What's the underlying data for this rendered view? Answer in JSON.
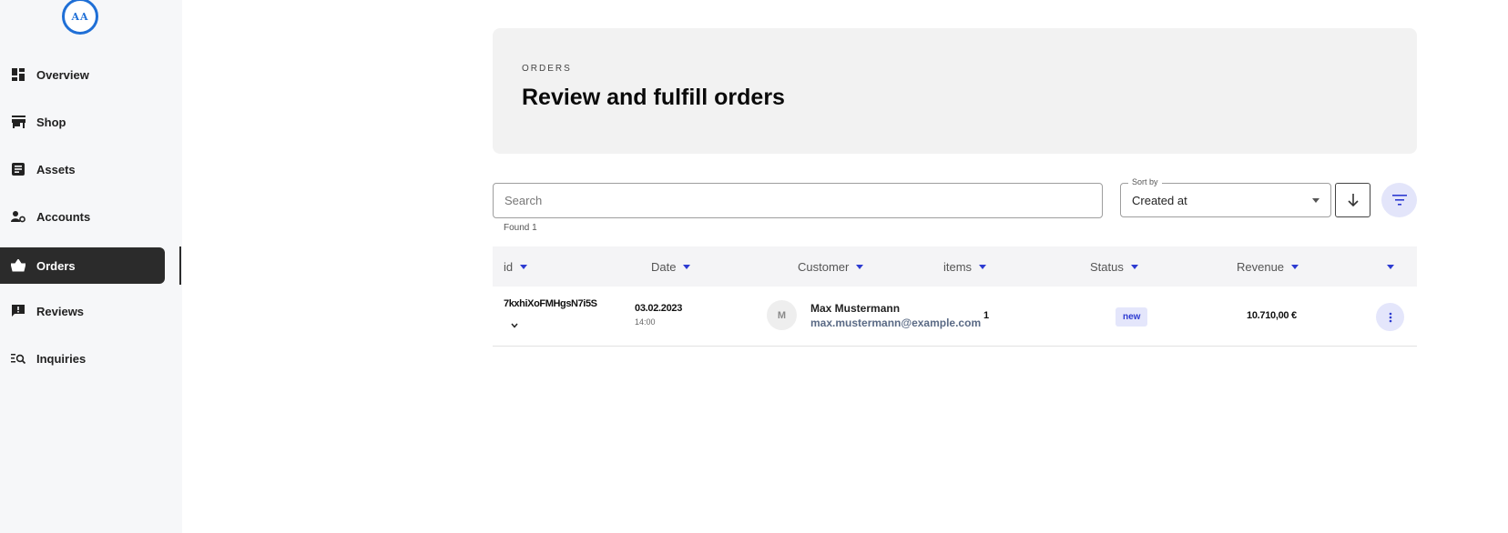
{
  "app": {
    "logo_text": "AA"
  },
  "sidebar": {
    "items": [
      {
        "label": "Overview",
        "icon": "dashboard-icon",
        "active": false
      },
      {
        "label": "Shop",
        "icon": "store-icon",
        "active": false
      },
      {
        "label": "Assets",
        "icon": "document-icon",
        "active": false
      },
      {
        "label": "Accounts",
        "icon": "account-settings-icon",
        "active": false
      },
      {
        "label": "Orders",
        "icon": "basket-icon",
        "active": true
      },
      {
        "label": "Reviews",
        "icon": "review-feedback-icon",
        "active": false
      },
      {
        "label": "Inquiries",
        "icon": "search-list-icon",
        "active": false
      }
    ]
  },
  "header": {
    "eyebrow": "ORDERS",
    "title": "Review and fulfill orders"
  },
  "search": {
    "placeholder": "Search",
    "value": "",
    "result_text": "Found 1"
  },
  "sort": {
    "legend": "Sort by",
    "selected": "Created at",
    "direction": "descending"
  },
  "table": {
    "columns": [
      "id",
      "Date",
      "Customer",
      "items",
      "Status",
      "Revenue",
      ""
    ],
    "rows": [
      {
        "id": "7kxhiXoFMHgsN7i5S",
        "date": "03.02.2023",
        "time": "14:00",
        "avatar_initial": "M",
        "customer_name": "Max Mustermann",
        "customer_email": "max.mustermann@example.com",
        "items": "1",
        "status": "new",
        "revenue": "10.710,00 €"
      }
    ]
  },
  "colors": {
    "accent": "#2d3bd1",
    "accent_soft": "#e4e6fb",
    "active_nav": "#2b2b2b",
    "logo": "#1f6fd6"
  }
}
